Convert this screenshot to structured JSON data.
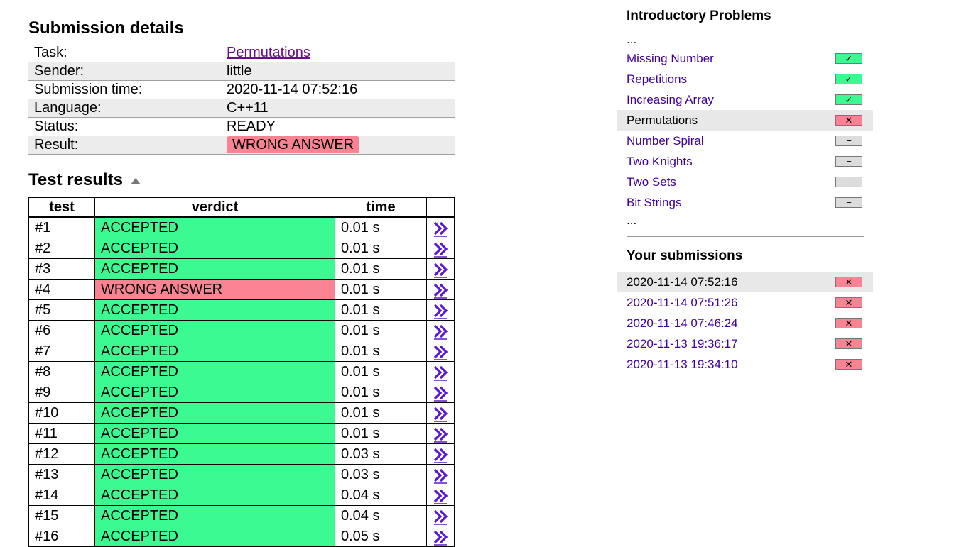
{
  "main": {
    "title": "Submission details",
    "details": [
      {
        "key": "Task:",
        "value": "Permutations",
        "type": "link"
      },
      {
        "key": "Sender:",
        "value": "little",
        "type": "text"
      },
      {
        "key": "Submission time:",
        "value": "2020-11-14 07:52:16",
        "type": "text"
      },
      {
        "key": "Language:",
        "value": "C++11",
        "type": "text"
      },
      {
        "key": "Status:",
        "value": "READY",
        "type": "text"
      },
      {
        "key": "Result:",
        "value": "WRONG ANSWER",
        "type": "badge"
      }
    ],
    "tests_title": "Test results",
    "columns": [
      "test",
      "verdict",
      "time"
    ],
    "tests": [
      {
        "id": "#1",
        "verdict": "ACCEPTED",
        "time": "0.01 s"
      },
      {
        "id": "#2",
        "verdict": "ACCEPTED",
        "time": "0.01 s"
      },
      {
        "id": "#3",
        "verdict": "ACCEPTED",
        "time": "0.01 s"
      },
      {
        "id": "#4",
        "verdict": "WRONG ANSWER",
        "time": "0.01 s"
      },
      {
        "id": "#5",
        "verdict": "ACCEPTED",
        "time": "0.01 s"
      },
      {
        "id": "#6",
        "verdict": "ACCEPTED",
        "time": "0.01 s"
      },
      {
        "id": "#7",
        "verdict": "ACCEPTED",
        "time": "0.01 s"
      },
      {
        "id": "#8",
        "verdict": "ACCEPTED",
        "time": "0.01 s"
      },
      {
        "id": "#9",
        "verdict": "ACCEPTED",
        "time": "0.01 s"
      },
      {
        "id": "#10",
        "verdict": "ACCEPTED",
        "time": "0.01 s"
      },
      {
        "id": "#11",
        "verdict": "ACCEPTED",
        "time": "0.01 s"
      },
      {
        "id": "#12",
        "verdict": "ACCEPTED",
        "time": "0.03 s"
      },
      {
        "id": "#13",
        "verdict": "ACCEPTED",
        "time": "0.03 s"
      },
      {
        "id": "#14",
        "verdict": "ACCEPTED",
        "time": "0.04 s"
      },
      {
        "id": "#15",
        "verdict": "ACCEPTED",
        "time": "0.04 s"
      },
      {
        "id": "#16",
        "verdict": "ACCEPTED",
        "time": "0.05 s"
      }
    ]
  },
  "sidebar": {
    "section_title": "Introductory Problems",
    "ellipsis": "...",
    "problems": [
      {
        "name": "Missing Number",
        "status": "ok",
        "current": false
      },
      {
        "name": "Repetitions",
        "status": "ok",
        "current": false
      },
      {
        "name": "Increasing Array",
        "status": "ok",
        "current": false
      },
      {
        "name": "Permutations",
        "status": "wa",
        "current": true
      },
      {
        "name": "Number Spiral",
        "status": "none",
        "current": false
      },
      {
        "name": "Two Knights",
        "status": "none",
        "current": false
      },
      {
        "name": "Two Sets",
        "status": "none",
        "current": false
      },
      {
        "name": "Bit Strings",
        "status": "none",
        "current": false
      }
    ],
    "submissions_title": "Your submissions",
    "submissions": [
      {
        "time": "2020-11-14 07:52:16",
        "status": "wa",
        "current": true
      },
      {
        "time": "2020-11-14 07:51:26",
        "status": "wa",
        "current": false
      },
      {
        "time": "2020-11-14 07:46:24",
        "status": "wa",
        "current": false
      },
      {
        "time": "2020-11-13 19:36:17",
        "status": "wa",
        "current": false
      },
      {
        "time": "2020-11-13 19:34:10",
        "status": "wa",
        "current": false
      }
    ]
  },
  "colors": {
    "accepted": "#3cfa92",
    "wrong": "#f88392",
    "link": "#41009c",
    "none": "#dcdcdc"
  },
  "icons": {
    "ok": "check-icon",
    "wa": "cross-icon",
    "none": "dash-icon",
    "test_link": "double-chevron-right-icon"
  }
}
